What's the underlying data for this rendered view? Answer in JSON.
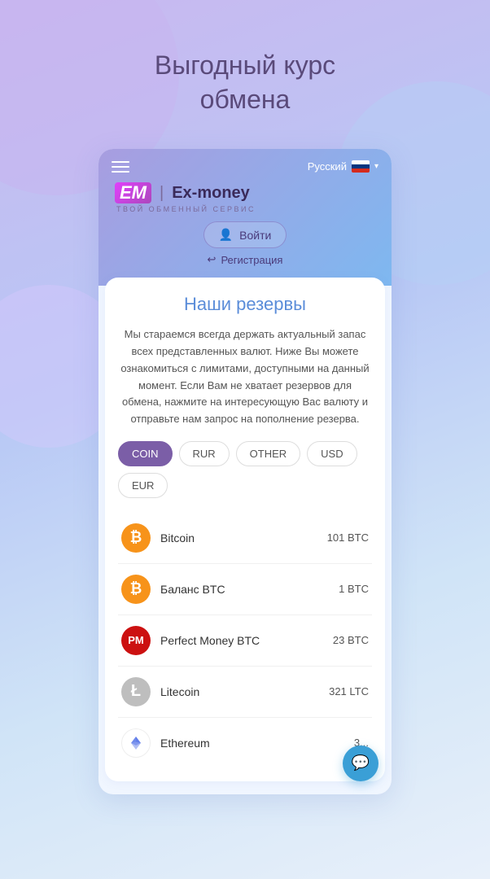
{
  "hero": {
    "title_line1": "Выгодный курс",
    "title_line2": "обмена"
  },
  "header": {
    "lang_label": "Русский",
    "brand_em": "EM",
    "brand_separator": "|",
    "brand_name": "Ex-money",
    "brand_tagline": "ТВОЙ ОБМЕННЫЙ СЕРВИС",
    "login_label": "Войти",
    "register_label": "Регистрация"
  },
  "reserves": {
    "title": "Наши резервы",
    "description": "Мы стараемся всегда держать актуальный запас всех представленных валют.\nНиже Вы можете ознакомиться с лимитами, доступными на данный момент.\nЕсли Вам не хватает резервов для обмена, нажмите на интересующую Вас валюту и отправьте нам запрос на пополнение резерва.",
    "filters": [
      {
        "id": "coin",
        "label": "COIN",
        "active": true
      },
      {
        "id": "rur",
        "label": "RUR",
        "active": false
      },
      {
        "id": "other",
        "label": "OTHER",
        "active": false
      },
      {
        "id": "usd",
        "label": "USD",
        "active": false
      },
      {
        "id": "eur",
        "label": "EUR",
        "active": false
      }
    ],
    "currencies": [
      {
        "id": "bitcoin",
        "name": "Bitcoin",
        "icon_type": "btc",
        "icon_text": "₿",
        "amount": "101 BTC"
      },
      {
        "id": "balance-btc",
        "name": "Баланс BTC",
        "icon_type": "btc",
        "icon_text": "₿",
        "amount": "1 BTC"
      },
      {
        "id": "perfect-money",
        "name": "Perfect Money BTC",
        "icon_type": "pm",
        "icon_text": "PM",
        "amount": "23 BTC"
      },
      {
        "id": "litecoin",
        "name": "Litecoin",
        "icon_type": "ltc",
        "icon_text": "Ł",
        "amount": "321 LTC"
      },
      {
        "id": "ethereum",
        "name": "Ethereum",
        "icon_type": "eth",
        "icon_text": "⟠",
        "amount": "3..."
      }
    ]
  },
  "fab": {
    "icon": "💬"
  }
}
